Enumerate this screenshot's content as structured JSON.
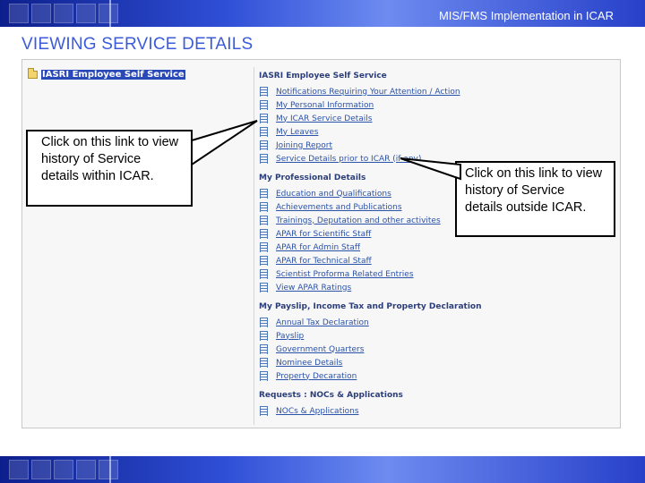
{
  "header": {
    "title": "MIS/FMS Implementation in ICAR"
  },
  "slide": {
    "title": "VIEWING SERVICE DETAILS"
  },
  "tree": {
    "root_label": "IASRI Employee Self Service"
  },
  "menu": {
    "sections": [
      {
        "title": "IASRI Employee Self Service",
        "items": [
          "Notifications Requiring Your Attention / Action",
          "My Personal Information",
          "My ICAR Service Details",
          "My Leaves",
          "Joining Report",
          "Service Details prior to ICAR (if any)"
        ]
      },
      {
        "title": "My Professional Details",
        "items": [
          "Education and Qualifications",
          "Achievements and Publications",
          "Trainings, Deputation and other activites",
          "APAR for Scientific Staff",
          "APAR for Admin Staff",
          "APAR for Technical Staff",
          "Scientist Proforma Related Entries",
          "View APAR Ratings"
        ]
      },
      {
        "title": "My Payslip, Income Tax and Property Declaration",
        "items": [
          "Annual Tax Declaration",
          "Payslip",
          "Government Quarters",
          "Nominee Details",
          "Property Decaration"
        ]
      },
      {
        "title": "Requests : NOCs & Applications",
        "items": [
          "NOCs & Applications"
        ]
      }
    ]
  },
  "callouts": {
    "left": "Click on this link to view history of Service details within ICAR.",
    "right": "Click on this link to view history of Service details outside ICAR."
  },
  "colors": {
    "band_dark": "#0d1f8c",
    "band_light": "#6d8bf0",
    "title": "#3b5bdb",
    "link": "#2a52a8",
    "section": "#2b3e7a"
  }
}
